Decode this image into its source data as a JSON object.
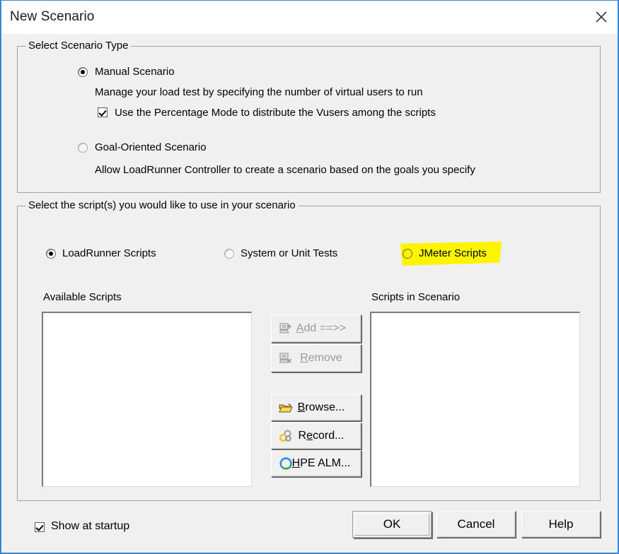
{
  "window": {
    "title": "New Scenario",
    "close_icon": "close-x-icon",
    "accent_border": "#3b87cf",
    "face_color": "#f0f0f0"
  },
  "scenario_type_group": {
    "legend": "Select Scenario Type",
    "options": [
      {
        "label": "Manual Scenario",
        "selected": true,
        "description": "Manage your load test by specifying the number of virtual users to run",
        "checkbox": {
          "label": "Use the Percentage Mode to distribute the Vusers among the scripts",
          "checked": true
        }
      },
      {
        "label": "Goal-Oriented Scenario",
        "selected": false,
        "description": "Allow LoadRunner Controller to create a scenario based on the goals you specify"
      }
    ]
  },
  "scripts_group": {
    "legend": "Select the script(s) you would like to use in your scenario",
    "script_type_options": [
      {
        "label": "LoadRunner Scripts",
        "selected": true,
        "highlighted": false
      },
      {
        "label": "System or Unit Tests",
        "selected": false,
        "highlighted": false
      },
      {
        "label": "JMeter Scripts",
        "selected": false,
        "highlighted": true
      }
    ],
    "highlight_color": "#fdf500",
    "available_label": "Available Scripts",
    "scenario_label": "Scripts in Scenario",
    "available_items": [],
    "scenario_items": [],
    "transfer_buttons": [
      {
        "label_pre": "A",
        "label_post": "dd ==>>",
        "icon": "add-script-icon",
        "disabled": true
      },
      {
        "label_pre": "R",
        "label_post": "emove",
        "icon": "remove-script-icon",
        "disabled": true
      }
    ],
    "action_buttons": [
      {
        "label_pre": "B",
        "label_post": "rowse...",
        "icon": "open-folder-icon",
        "disabled": false
      },
      {
        "label_pre": "R",
        "label_post": "ecord...",
        "icon": "record-rings-icon",
        "disabled": false,
        "prefix": "R",
        "mid": "e",
        "rest": "cord..."
      },
      {
        "label_pre": "H",
        "label_post": "PE ALM...",
        "icon": "hpe-alm-icon",
        "disabled": false
      }
    ]
  },
  "footer": {
    "show_at_startup": {
      "label": "Show at startup",
      "checked": true
    },
    "buttons": [
      {
        "label": "OK",
        "default": true
      },
      {
        "label": "Cancel",
        "default": false
      },
      {
        "label": "Help",
        "default": false
      }
    ]
  }
}
